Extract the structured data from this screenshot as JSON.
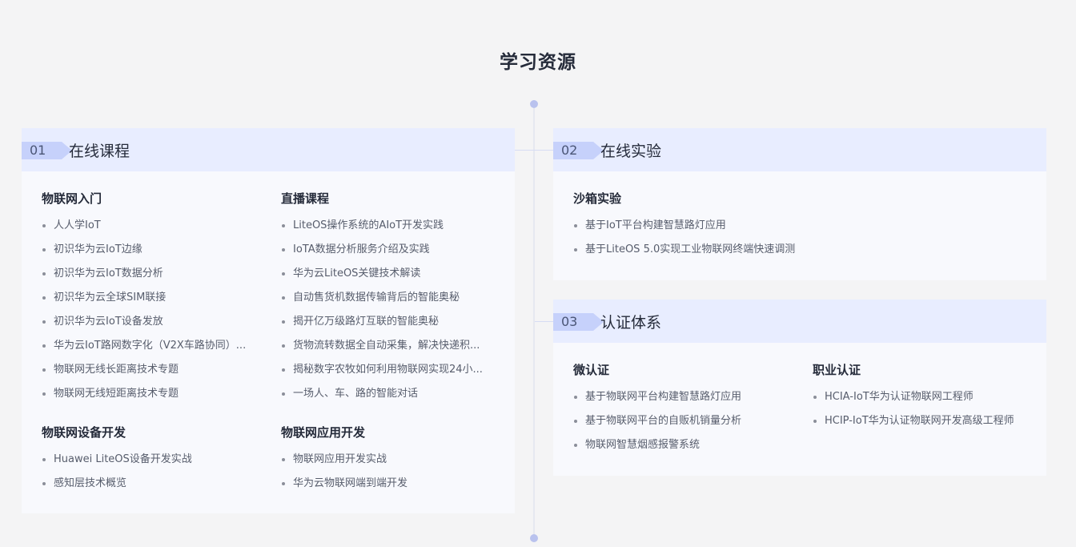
{
  "page_title": "学习资源",
  "sections": {
    "online_courses": {
      "num": "01",
      "title": "在线课程",
      "groups": [
        {
          "title": "物联网入门",
          "items": [
            "人人学IoT",
            "初识华为云IoT边缘",
            "初识华为云IoT数据分析",
            "初识华为云全球SIM联接",
            "初识华为云IoT设备发放",
            "华为云IoT路网数字化（V2X车路协同）...",
            "物联网无线长距离技术专题",
            "物联网无线短距离技术专题"
          ]
        },
        {
          "title": "直播课程",
          "items": [
            "LiteOS操作系统的AIoT开发实践",
            "IoTA数据分析服务介绍及实践",
            "华为云LiteOS关键技术解读",
            "自动售货机数据传输背后的智能奥秘",
            "揭开亿万级路灯互联的智能奥秘",
            "货物流转数据全自动采集，解决快递积...",
            "揭秘数字农牧如何利用物联网实现24小...",
            "一场人、车、路的智能对话"
          ]
        },
        {
          "title": "物联网设备开发",
          "items": [
            "Huawei LiteOS设备开发实战",
            "感知层技术概览"
          ]
        },
        {
          "title": "物联网应用开发",
          "items": [
            "物联网应用开发实战",
            "华为云物联网端到端开发"
          ]
        }
      ]
    },
    "online_labs": {
      "num": "02",
      "title": "在线实验",
      "groups": [
        {
          "title": "沙箱实验",
          "items": [
            "基于IoT平台构建智慧路灯应用",
            "基于LiteOS 5.0实现工业物联网终端快速调测"
          ]
        }
      ]
    },
    "certification": {
      "num": "03",
      "title": "认证体系",
      "groups": [
        {
          "title": "微认证",
          "items": [
            "基于物联网平台构建智慧路灯应用",
            "基于物联网平台的自贩机销量分析",
            "物联网智慧烟感报警系统"
          ]
        },
        {
          "title": "职业认证",
          "items": [
            "HCIA-IoT华为认证物联网工程师",
            "HCIP-IoT华为认证物联网开发高级工程师"
          ]
        }
      ]
    }
  }
}
